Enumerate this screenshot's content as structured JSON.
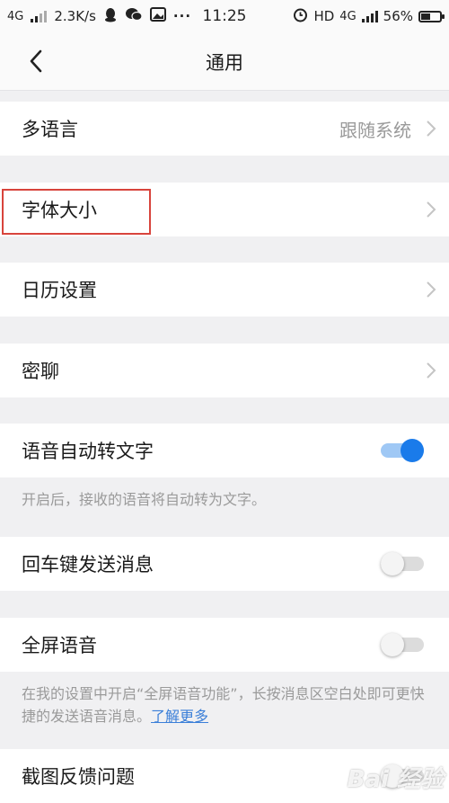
{
  "status_bar": {
    "network_left": "4G",
    "speed": "2.3K/s",
    "notification_icons": [
      "qq-icon",
      "wechat-icon",
      "gallery-icon"
    ],
    "more": "···",
    "time": "11:25",
    "alarm_icon": "alarm-icon",
    "hd": "HD",
    "network_right": "4G",
    "battery_percent": "56%",
    "battery_level": 0.56
  },
  "header": {
    "title": "通用",
    "back_icon": "chevron-left-icon"
  },
  "settings": {
    "language": {
      "label": "多语言",
      "value": "跟随系统"
    },
    "font_size": {
      "label": "字体大小"
    },
    "calendar": {
      "label": "日历设置"
    },
    "secret_chat": {
      "label": "密聊"
    },
    "voice_to_text": {
      "label": "语音自动转文字",
      "enabled": true,
      "description": "开启后，接收的语音将自动转为文字。"
    },
    "enter_send": {
      "label": "回车键发送消息",
      "enabled": false
    },
    "fullscreen_voice": {
      "label": "全屏语音",
      "enabled": false,
      "description": "在我的设置中开启“全屏语音功能”，长按消息区空白处即可更快捷的发送语音消息。",
      "link": "了解更多"
    },
    "screenshot_feedback": {
      "label": "截图反馈问题"
    }
  },
  "colors": {
    "accent": "#1a7bea",
    "highlight_border": "#d8443c",
    "link": "#3b7fd8"
  },
  "watermark": "Bai 经验"
}
